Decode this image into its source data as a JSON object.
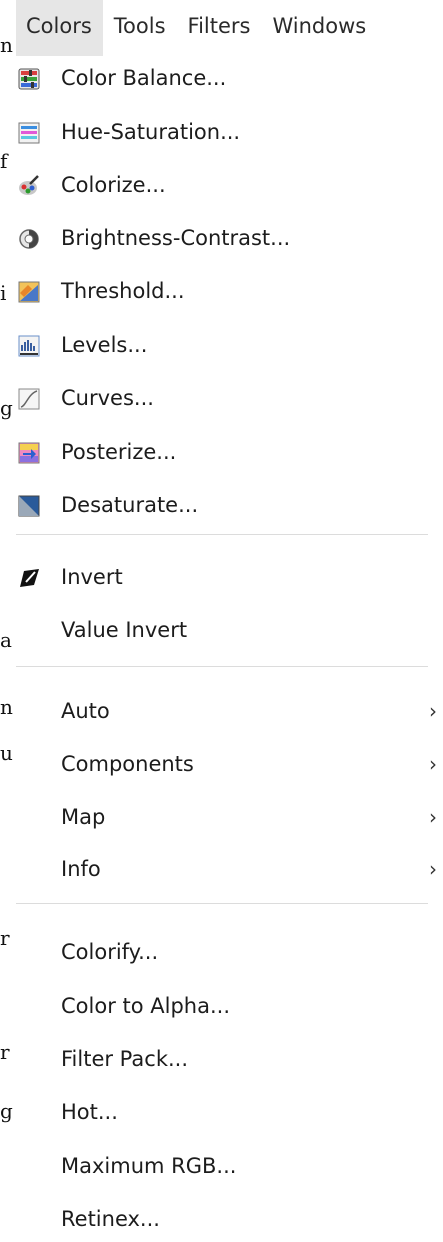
{
  "background_doc": {
    "fragments": [
      "n",
      "f",
      "i",
      "g",
      "a",
      "n",
      "u",
      "r",
      "r",
      "g"
    ]
  },
  "menubar": {
    "items": [
      {
        "label": "Colors",
        "active": true
      },
      {
        "label": "Tools"
      },
      {
        "label": "Filters"
      },
      {
        "label": "Windows"
      }
    ]
  },
  "menu": {
    "items": [
      {
        "label": "Color Balance...",
        "icon": "color-balance-icon"
      },
      {
        "label": "Hue-Saturation...",
        "icon": "hue-saturation-icon"
      },
      {
        "label": "Colorize...",
        "icon": "colorize-icon"
      },
      {
        "label": "Brightness-Contrast...",
        "icon": "brightness-contrast-icon"
      },
      {
        "label": "Threshold...",
        "icon": "threshold-icon"
      },
      {
        "label": "Levels...",
        "icon": "levels-icon"
      },
      {
        "label": "Curves...",
        "icon": "curves-icon"
      },
      {
        "label": "Posterize...",
        "icon": "posterize-icon"
      },
      {
        "label": "Desaturate...",
        "icon": "desaturate-icon"
      },
      {
        "label": "Invert",
        "icon": "invert-icon"
      },
      {
        "label": "Value Invert"
      },
      {
        "label": "Auto",
        "submenu": true
      },
      {
        "label": "Components",
        "submenu": true
      },
      {
        "label": "Map",
        "submenu": true
      },
      {
        "label": "Info",
        "submenu": true
      },
      {
        "label": "Colorify..."
      },
      {
        "label": "Color to Alpha..."
      },
      {
        "label": "Filter Pack..."
      },
      {
        "label": "Hot..."
      },
      {
        "label": "Maximum RGB..."
      },
      {
        "label": "Retinex..."
      }
    ],
    "submenu_arrow": "›"
  }
}
